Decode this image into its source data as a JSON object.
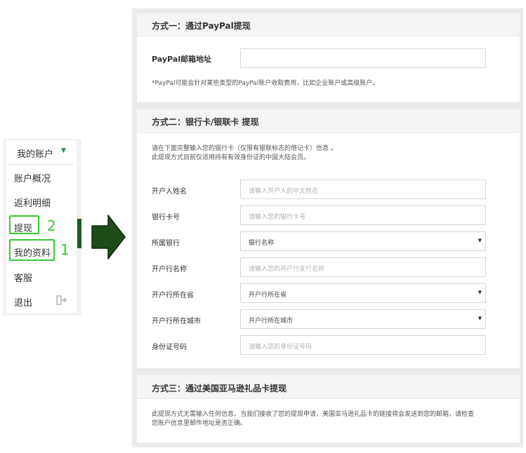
{
  "menu": {
    "title": "我的账户",
    "caret": "▼",
    "items": [
      "账户概况",
      "返利明细",
      "提现",
      "我的资料",
      "客服",
      "退出"
    ]
  },
  "annotations": {
    "num_withdraw": "2",
    "num_profile": "1"
  },
  "colors": {
    "highlight": "#35c835",
    "arrow": "#1f4a1a",
    "accent_green": "#2a8a3a"
  },
  "icons": {
    "logout": "logout-icon",
    "arrow": "right-arrow-icon"
  },
  "section1": {
    "title": "方式一：通过PayPal提现",
    "label_email": "PayPal邮箱地址",
    "email_value": "",
    "note": "*PayPal可能会针对某些类型的PayPal账户收取费用，比如企业账户或高级账户。"
  },
  "section2": {
    "title": "方式二：银行卡/银联卡 提现",
    "intro_line1": "请在下面完整输入您的银行卡（仅限有银联标志的借记卡）信息 。",
    "intro_line2": "此提现方式目前仅适用持有有效身份证的中国大陆会员。",
    "fields": [
      {
        "label": "开户人姓名",
        "placeholder": "请输入开户人的中文姓名"
      },
      {
        "label": "银行卡号",
        "placeholder": "请输入您的银行卡号"
      },
      {
        "label": "所属银行",
        "value": "银行名称"
      },
      {
        "label": "开户行名称",
        "placeholder": "请输入您的开户行支行名称"
      },
      {
        "label": "开户行所在省",
        "value": "开户行所在省"
      },
      {
        "label": "开户行所在城市",
        "value": "开户行所在城市"
      },
      {
        "label": "身份证号码",
        "placeholder": "请输入您的身份证号码"
      }
    ],
    "select_caret": "▼"
  },
  "section3": {
    "title": "方式三：通过美国亚马逊礼品卡提现",
    "note_line1": "此提现方式无需输入任何信息。当我们接收了您的提现申请，美国亚马逊礼品卡的链接将会发送到您的邮箱，请检查",
    "note_line2": "您账户信息里邮件地址是否正确。"
  }
}
